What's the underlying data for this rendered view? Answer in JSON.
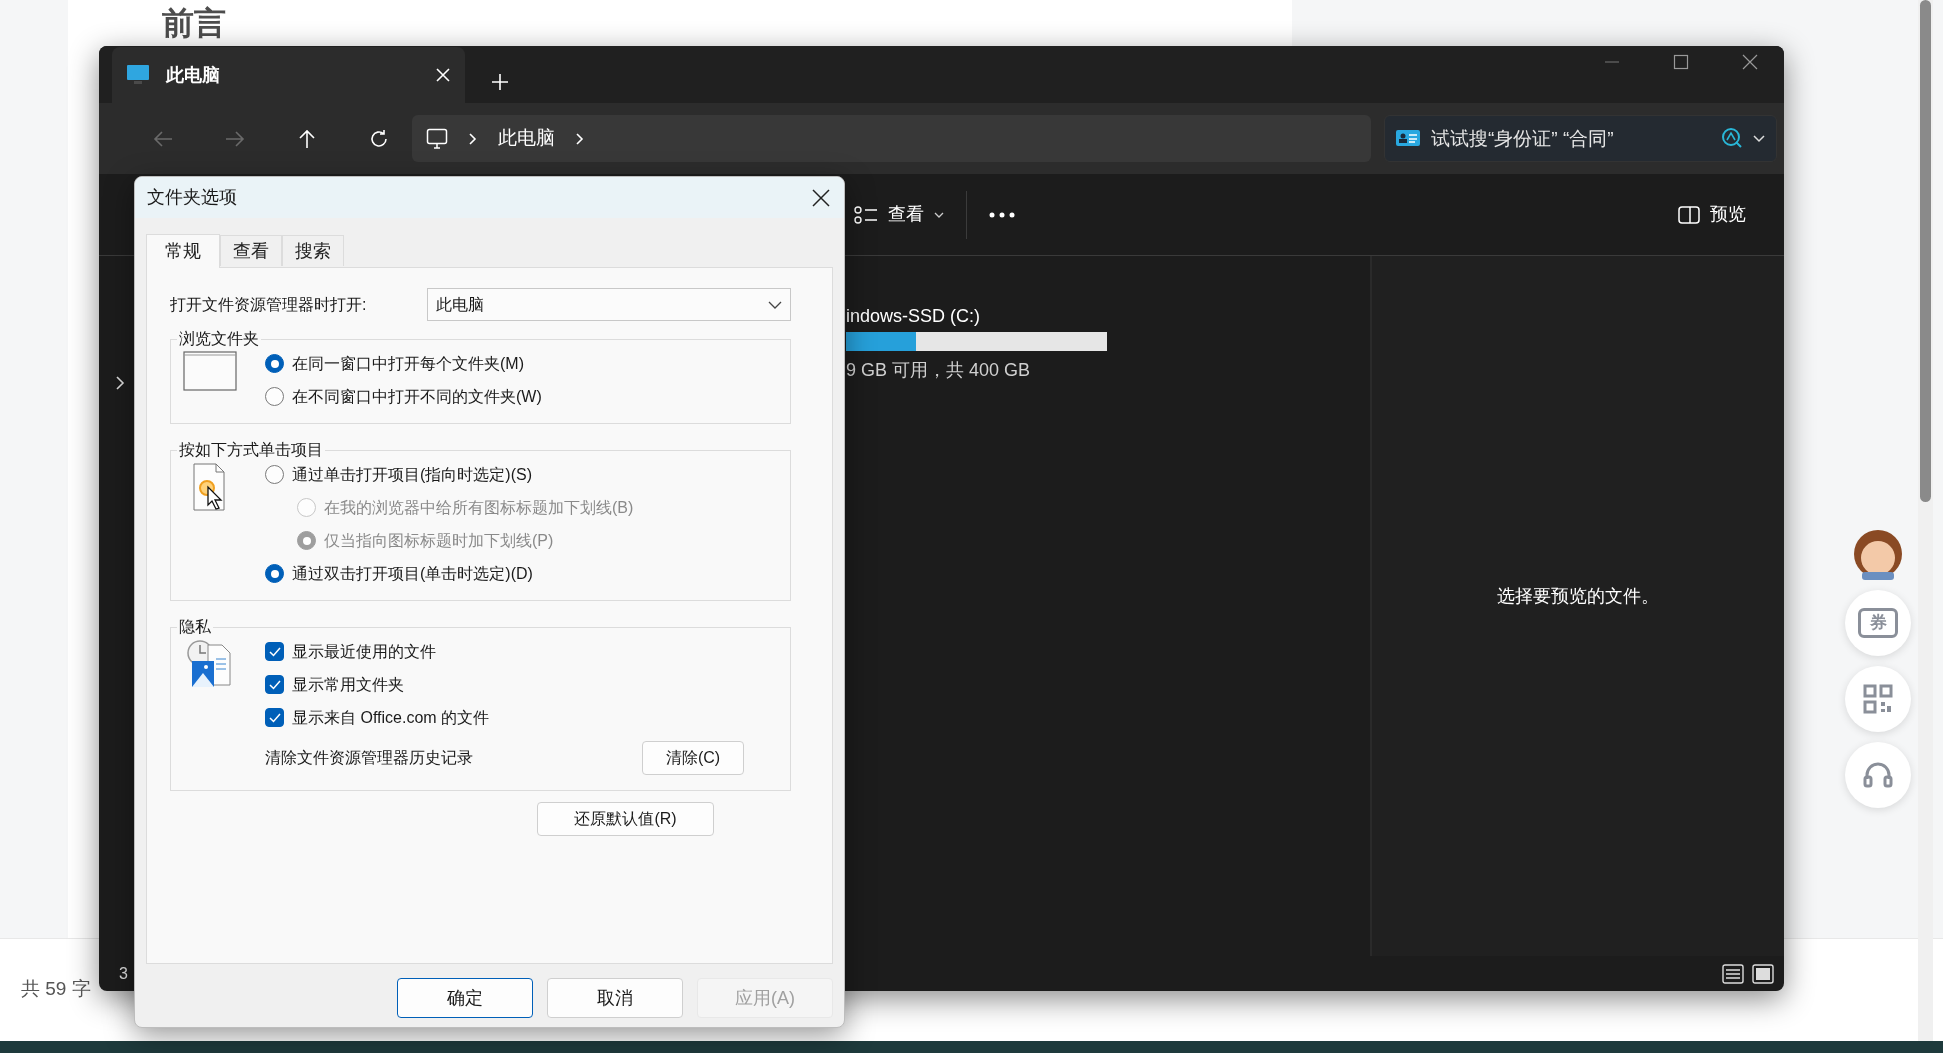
{
  "page": {
    "heading": "前言",
    "word_count": "共 59 字",
    "tools": [
      {
        "kind": "mascot"
      },
      {
        "kind": "coupon",
        "label": "券"
      },
      {
        "kind": "qr"
      },
      {
        "kind": "support"
      }
    ]
  },
  "explorer": {
    "tab": {
      "title": "此电脑"
    },
    "breadcrumb": [
      "此电脑"
    ],
    "search": {
      "placeholder": "试试搜“身份证” “合同”"
    },
    "commands": [
      {
        "kind": "view",
        "label": "查看"
      },
      {
        "kind": "more"
      },
      {
        "kind": "preview",
        "label": "预览"
      }
    ],
    "drive": {
      "name": "indows-SSD (C:)",
      "level": 0.27,
      "space": "9 GB 可用，共 400 GB"
    },
    "preview_message": "选择要预览的文件。",
    "status": "3"
  },
  "dialog": {
    "title": "文件夹选项",
    "tabs": [
      {
        "label": "常规",
        "selected": true
      },
      {
        "label": "查看",
        "selected": false
      },
      {
        "label": "搜索",
        "selected": false
      }
    ],
    "open_in": {
      "label": "打开文件资源管理器时打开:",
      "value": "此电脑"
    },
    "groups": [
      {
        "title": "浏览文件夹",
        "options": [
          {
            "kind": "radio",
            "label": "在同一窗口中打开每个文件夹(M)",
            "checked": true,
            "disabled": false
          },
          {
            "kind": "radio",
            "label": "在不同窗口中打开不同的文件夹(W)",
            "checked": false,
            "disabled": false
          }
        ]
      },
      {
        "title": "按如下方式单击项目",
        "options": [
          {
            "kind": "radio",
            "label": "通过单击打开项目(指向时选定)(S)",
            "checked": false,
            "disabled": false,
            "children": [
              {
                "kind": "radio",
                "label": "在我的浏览器中给所有图标标题加下划线(B)",
                "checked": false,
                "disabled": true
              },
              {
                "kind": "radio",
                "label": "仅当指向图标标题时加下划线(P)",
                "checked": true,
                "disabled": true
              }
            ]
          },
          {
            "kind": "radio",
            "label": "通过双击打开项目(单击时选定)(D)",
            "checked": true,
            "disabled": false
          }
        ]
      },
      {
        "title": "隐私",
        "options": [
          {
            "kind": "checkbox",
            "label": "显示最近使用的文件",
            "checked": true
          },
          {
            "kind": "checkbox",
            "label": "显示常用文件夹",
            "checked": true
          },
          {
            "kind": "checkbox",
            "label": "显示来自 Office.com 的文件",
            "checked": true
          }
        ],
        "action": {
          "label": "清除文件资源管理器历史记录",
          "button": "清除(C)"
        }
      }
    ],
    "restore": "还原默认值(R)",
    "buttons": [
      {
        "label": "确定",
        "default": true,
        "disabled": false
      },
      {
        "label": "取消",
        "default": false,
        "disabled": false
      },
      {
        "label": "应用(A)",
        "default": false,
        "disabled": true
      }
    ]
  }
}
